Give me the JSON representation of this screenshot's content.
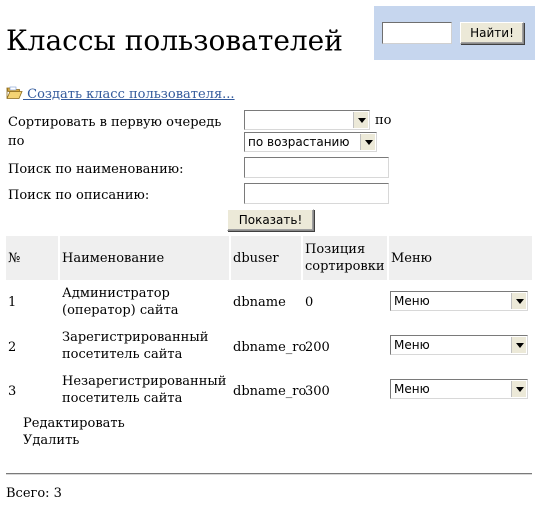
{
  "search": {
    "value": "",
    "button_label": "Найти!"
  },
  "page_title": "Классы пользователей",
  "create_link": " Создать класс пользователя...",
  "filters": {
    "sort_label_line1": "Сортировать в первую очередь",
    "sort_label_line2": "по",
    "sort_field_value": "",
    "sort_suffix": "по",
    "sort_order_value": "по возрастанию",
    "name_search_label": "Поиск по наименованию:",
    "desc_search_label": "Поиск по описанию:",
    "name_search_value": "",
    "desc_search_value": "",
    "show_button": "Показать!"
  },
  "table": {
    "headers": {
      "num": "№",
      "name": "Наименование",
      "dbuser": "dbuser",
      "pos_line1": "Позиция",
      "pos_line2": "сортировки",
      "menu": "Меню"
    },
    "rows": [
      {
        "num": "1",
        "name_line1": "Администратор",
        "name_line2": "(оператор) сайта",
        "dbuser": "dbname",
        "position": "0",
        "menu": "Меню"
      },
      {
        "num": "2",
        "name_line1": "Зарегистрированный",
        "name_line2": "посетитель сайта",
        "dbuser": "dbname_ro",
        "position": "200",
        "menu": "Меню"
      },
      {
        "num": "3",
        "name_line1": "Незарегистрированный",
        "name_line2": "посетитель сайта",
        "dbuser": "dbname_ro",
        "position": "300",
        "menu": "Меню"
      }
    ]
  },
  "actions": {
    "edit": "Редактировать",
    "delete": "Удалить"
  },
  "total": "Всего: 3",
  "colors": {
    "search_panel_bg": "#c6d6ee",
    "link": "#335a9c",
    "header_bg": "#efefef"
  }
}
